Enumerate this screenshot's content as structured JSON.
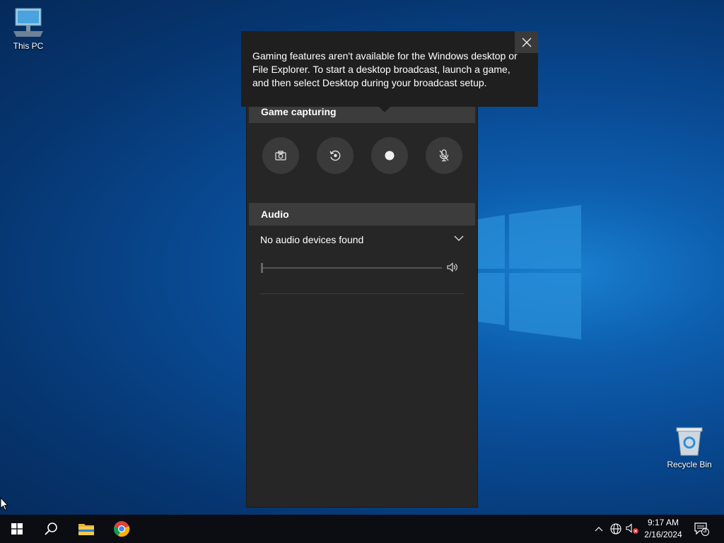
{
  "desktop": {
    "icons": [
      {
        "label": "This PC",
        "icon": "computer-icon"
      },
      {
        "label": "Recycle Bin",
        "icon": "recycle-bin-icon"
      }
    ]
  },
  "tooltip": {
    "message": "Gaming features aren't available for the Windows desktop or File Explorer. To start a desktop broadcast, launch a game, and then select Desktop during your broadcast setup.",
    "close_icon": "close-icon"
  },
  "game_bar": {
    "capture_section": {
      "title": "Game capturing",
      "buttons": [
        {
          "icon": "camera-icon"
        },
        {
          "icon": "record-last-icon"
        },
        {
          "icon": "record-dot-icon"
        },
        {
          "icon": "mic-off-icon"
        }
      ]
    },
    "audio_section": {
      "title": "Audio",
      "device": "No audio devices found",
      "volume_level": 0
    }
  },
  "taskbar": {
    "pinned": [
      {
        "icon": "windows-start-icon"
      },
      {
        "icon": "search-icon"
      },
      {
        "icon": "file-explorer-icon"
      },
      {
        "icon": "chrome-icon"
      }
    ],
    "tray": {
      "icons": [
        "chevron-up-icon",
        "network-icon",
        "volume-muted-icon"
      ],
      "time": "9:17 AM",
      "date": "2/16/2024",
      "notification_count": "3"
    }
  }
}
